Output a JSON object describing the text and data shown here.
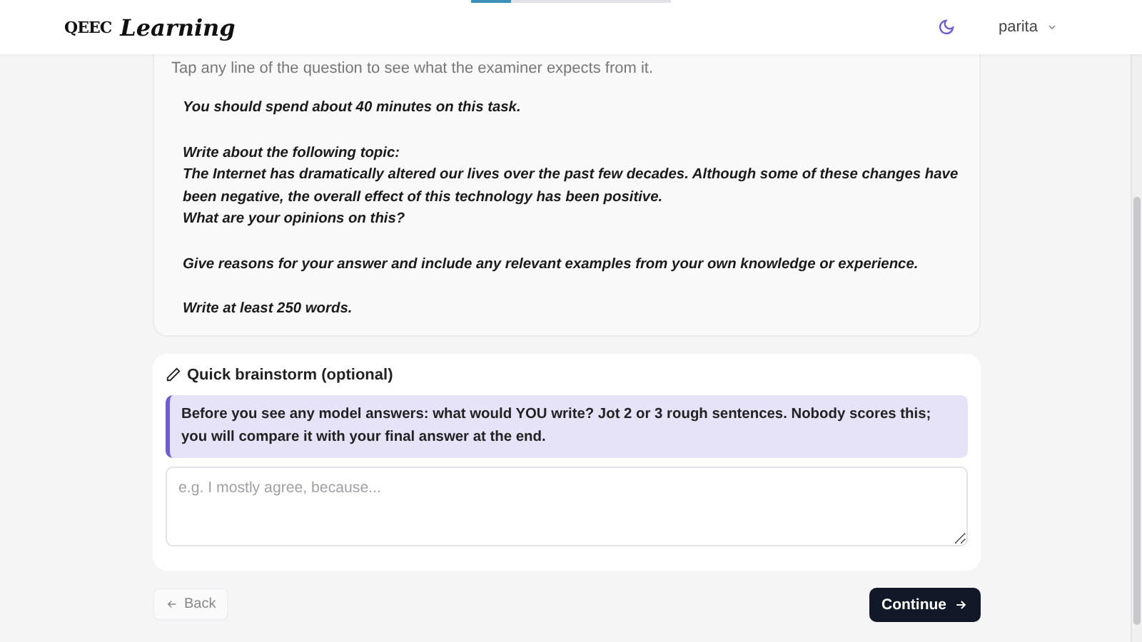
{
  "progress": {
    "level": 0.2
  },
  "header": {
    "logo_mark": "QEEC",
    "logo_text": "Learning",
    "user": "parita"
  },
  "question": {
    "hint": "Tap any line of the question to see what the examiner expects from it.",
    "paragraphs": [
      [
        "You should spend about 40 minutes on this task."
      ],
      [
        "Write about the following topic:",
        "The Internet has dramatically altered our lives over the past few decades. Although some of these changes have been negative, the overall effect of this technology has been positive.",
        "What are your opinions on this?"
      ],
      [
        "Give reasons for your answer and include any relevant examples from your own knowledge or experience."
      ],
      [
        "Write at least 250 words."
      ]
    ]
  },
  "brainstorm": {
    "title": "Quick brainstorm (optional)",
    "note": "Before you see any model answers: what would YOU write? Jot 2 or 3 rough sentences. Nobody scores this; you will compare it with your final answer at the end.",
    "placeholder": "e.g. I mostly agree, because..."
  },
  "buttons": {
    "back": "Back",
    "continue": "Continue"
  }
}
